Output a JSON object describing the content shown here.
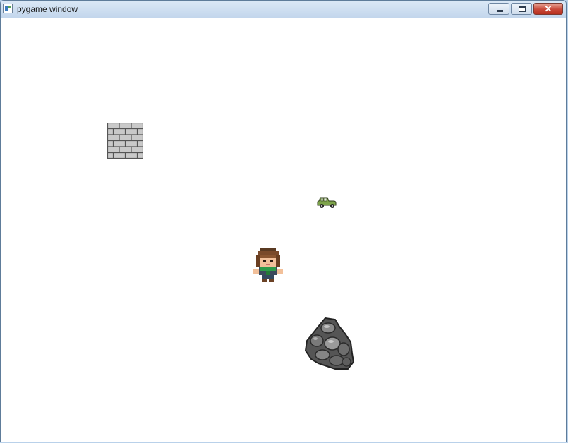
{
  "window": {
    "title": "pygame window",
    "controls": {
      "minimize_icon": "minimize-icon",
      "maximize_icon": "maximize-icon",
      "close_label": "✕"
    }
  },
  "scene": {
    "background": "#ffffff",
    "sprites": [
      "brick-wall",
      "car",
      "player-character",
      "rock"
    ]
  }
}
